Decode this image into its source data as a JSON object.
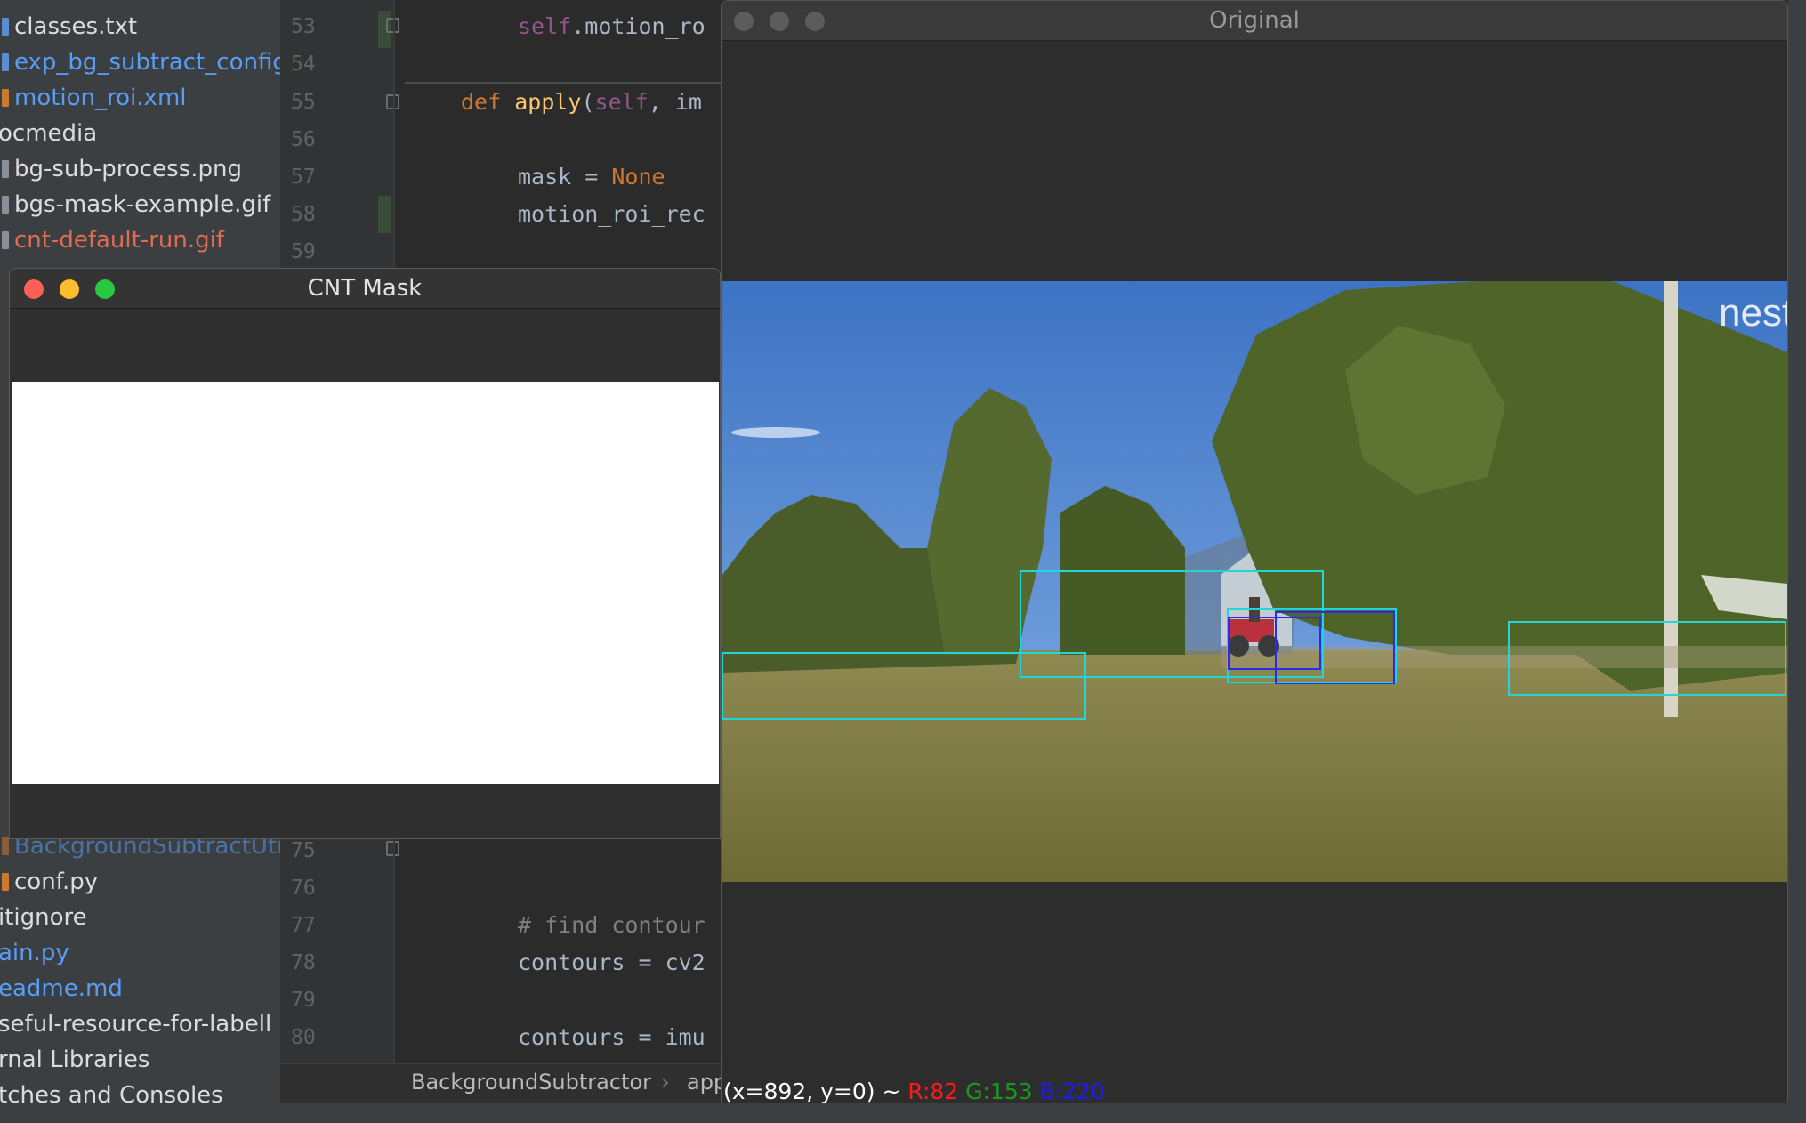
{
  "project_tree": {
    "items": [
      {
        "label": "classes.txt",
        "color": "default",
        "icon": "config-file-icon"
      },
      {
        "label": "exp_bg_subtract_config",
        "color": "blue",
        "icon": "config-file-icon"
      },
      {
        "label": "motion_roi.xml",
        "color": "blue",
        "icon": "xml-file-icon"
      },
      {
        "label": "ocmedia",
        "color": "default",
        "icon": "none"
      },
      {
        "label": "bg-sub-process.png",
        "color": "default",
        "icon": "image-file-icon"
      },
      {
        "label": "bgs-mask-example.gif",
        "color": "default",
        "icon": "image-file-icon"
      },
      {
        "label": "cnt-default-run.gif",
        "color": "red",
        "icon": "image-file-icon"
      },
      {
        "label": "BackgroundSubtractUti",
        "color": "blue",
        "icon": "python-file-icon"
      },
      {
        "label": "conf.py",
        "color": "default",
        "icon": "python-file-icon"
      },
      {
        "label": "itignore",
        "color": "default",
        "icon": "none"
      },
      {
        "label": "ain.py",
        "color": "blue",
        "icon": "none"
      },
      {
        "label": "eadme.md",
        "color": "blue",
        "icon": "none"
      },
      {
        "label": "seful-resource-for-labell",
        "color": "default",
        "icon": "none"
      },
      {
        "label": "rnal Libraries",
        "color": "default",
        "icon": "none"
      },
      {
        "label": "tches and Consoles",
        "color": "default",
        "icon": "none"
      }
    ]
  },
  "editor": {
    "line_numbers": [
      "53",
      "54",
      "55",
      "56",
      "57",
      "58",
      "59",
      "75",
      "76",
      "77",
      "78",
      "79",
      "80"
    ],
    "code": {
      "l53": {
        "self": "self",
        "rest": ".motion_ro"
      },
      "l55": {
        "kw": "def ",
        "fn": "apply",
        "p1": "(",
        "self": "self",
        "p2": ", im"
      },
      "l57": {
        "var": "mask = ",
        "kw": "None"
      },
      "l58": "motion_roi_rec",
      "l77": "# find contour",
      "l78": "contours = cv2",
      "l80": "contours = imu"
    },
    "breadcrumb": [
      "BackgroundSubtractor",
      "›",
      "app"
    ]
  },
  "windows": {
    "cnt_mask": {
      "title": "CNT Mask"
    },
    "original": {
      "title": "Original",
      "watermark": "nest",
      "status": {
        "coords": "(x=892, y=0) ~",
        "r": "R:82",
        "g": "G:153",
        "b": "B:220"
      }
    }
  },
  "colors": {
    "traffic_close": "#ff5f57",
    "traffic_minimize": "#febc2e",
    "traffic_zoom": "#28c840",
    "detection_cyan": "#22d6d6",
    "detection_blue": "#2a2aee"
  }
}
